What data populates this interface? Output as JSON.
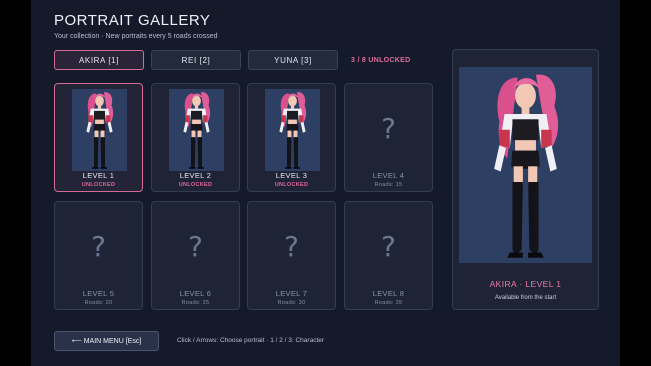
{
  "header": {
    "title": "PORTRAIT GALLERY",
    "subtitle": "Your collection · New portraits every 5 roads crossed"
  },
  "tabs": [
    {
      "label": "AKIRA   [1]",
      "active": true
    },
    {
      "label": "REI   [2]",
      "active": false
    },
    {
      "label": "YUNA   [3]",
      "active": false
    }
  ],
  "unlock_count": "3 / 8 UNLOCKED",
  "cards": [
    {
      "level": "LEVEL 1",
      "status": "UNLOCKED",
      "unlocked": true,
      "selected": true
    },
    {
      "level": "LEVEL 2",
      "status": "UNLOCKED",
      "unlocked": true
    },
    {
      "level": "LEVEL 3",
      "status": "UNLOCKED",
      "unlocked": true
    },
    {
      "level": "LEVEL 4",
      "status": "Roads: 15",
      "unlocked": false
    },
    {
      "level": "LEVEL 5",
      "status": "Roads: 20",
      "unlocked": false
    },
    {
      "level": "LEVEL 6",
      "status": "Roads: 25",
      "unlocked": false
    },
    {
      "level": "LEVEL 7",
      "status": "Roads: 30",
      "unlocked": false
    },
    {
      "level": "LEVEL 8",
      "status": "Roads: 35",
      "unlocked": false
    }
  ],
  "locked_symbol": "?",
  "preview": {
    "name": "AKIRA · LEVEL 1",
    "description": "Available from the start"
  },
  "footer": {
    "menu_button": "⟵ MAIN MENU  [Esc]",
    "hint": "Click / Arrows: Choose portrait · 1 / 2 / 3: Character"
  },
  "colors": {
    "accent_pink": "#e0669a",
    "background": "#151a2a",
    "card": "#1e2435",
    "portrait_bg": "#2d3f62"
  }
}
